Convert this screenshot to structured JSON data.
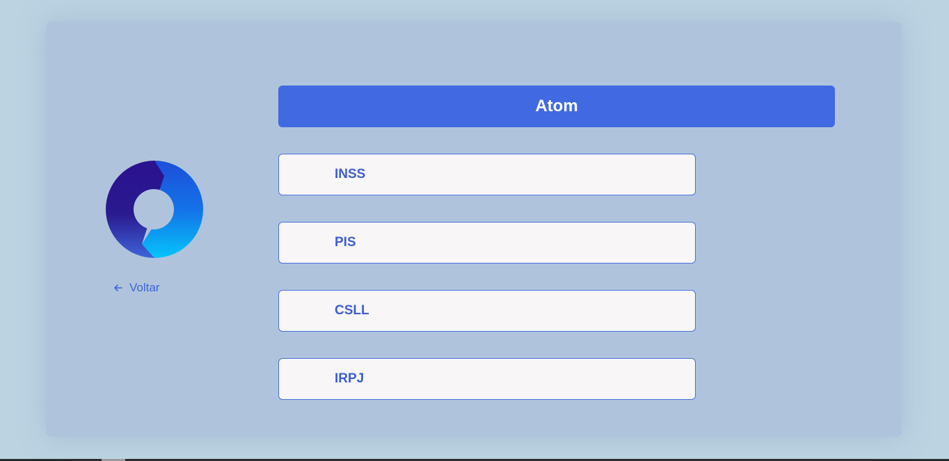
{
  "title": "Atom",
  "back": {
    "label": "Voltar",
    "icon": "arrow-left-icon"
  },
  "logo": {
    "icon": "ring-logo-icon"
  },
  "options": [
    {
      "label": "INSS"
    },
    {
      "label": "PIS"
    },
    {
      "label": "CSLL"
    },
    {
      "label": "IRPJ"
    }
  ],
  "colors": {
    "background": "#bcd3e2",
    "panel": "#afc4dc",
    "accent": "#4169e1",
    "option_bg": "#f8f6f6",
    "option_text": "#3d5fcf"
  }
}
